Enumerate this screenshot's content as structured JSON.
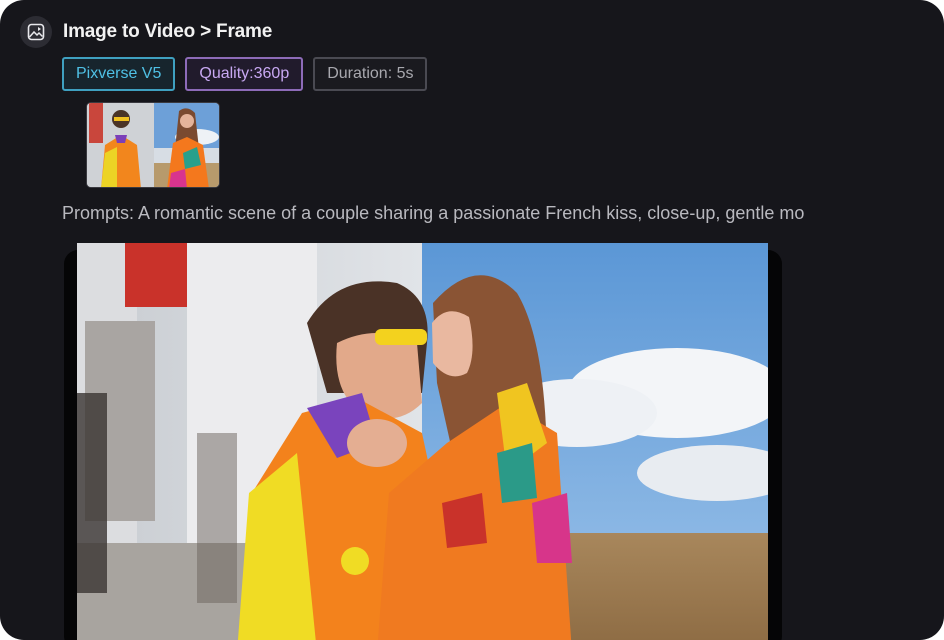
{
  "header": {
    "title": "Image to Video > Frame",
    "icon": "image-to-video-icon"
  },
  "tags": {
    "model": "Pixverse V5",
    "quality": "Quality:360p",
    "duration": "Duration: 5s"
  },
  "colors": {
    "background": "#16161b",
    "model_accent": "#4fc0e4",
    "quality_accent": "#c8a8f2",
    "duration_text": "#a8a8ae"
  },
  "reference_image": {
    "icon": "reference-thumbnail"
  },
  "prompt": {
    "text": "Prompts: A romantic scene of a couple sharing a passionate French kiss, close-up, gentle mo"
  },
  "video": {
    "icon": "generated-video-preview"
  }
}
